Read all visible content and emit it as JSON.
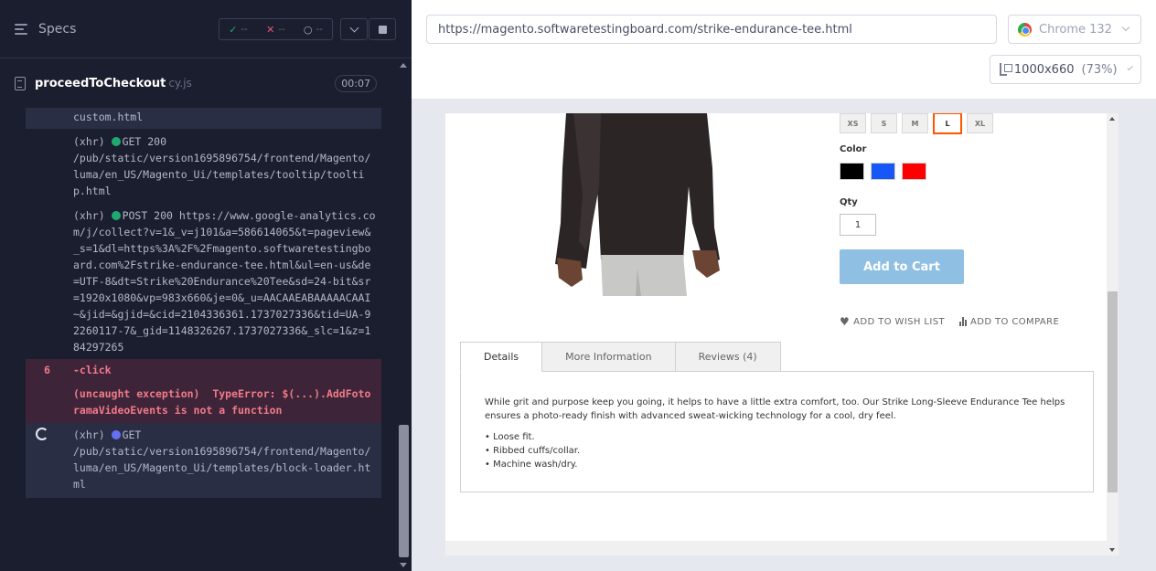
{
  "reporter": {
    "specs_label": "Specs",
    "stats": {
      "passed": "--",
      "failed": "--",
      "pending": "--"
    },
    "spec_name": "proceedToCheckout",
    "spec_ext": "cy.js",
    "duration": "00:07",
    "log": [
      {
        "text": "custom.html"
      },
      {
        "method": "(xhr)",
        "status": "GET 200",
        "url": "/pub/static/version1695896754/frontend/Magento/luma/en_US/Magento_Ui/templates/tooltip/tooltip.html"
      },
      {
        "method": "(xhr)",
        "status": "POST 200",
        "url": "https://www.google-analytics.com/j/collect?v=1&_v=j101&a=586614065&t=pageview&_s=1&dl=https%3A%2F%2Fmagento.softwaretestingboard.com%2Fstrike-endurance-tee.html&ul=en-us&de=UTF-8&dt=Strike%20Endurance%20Tee&sd=24-bit&sr=1920x1080&vp=983x660&je=0&_u=AACAAEABAAAAACAAI~&jid=&gjid=&cid=2104336361.1737027336&tid=UA-92260117-7&_gid=1148326267.1737027336&_slc=1&z=184297265"
      },
      {
        "line": "6",
        "command": "-click"
      },
      {
        "error": "(uncaught exception)  TypeError: $(...).AddFotoramaVideoEvents is not a function"
      },
      {
        "method": "(xhr)",
        "status": "GET",
        "url": "/pub/static/version1695896754/frontend/Magento/luma/en_US/Magento_Ui/templates/block-loader.html"
      }
    ]
  },
  "aut": {
    "url": "https://magento.softwaretestingboard.com/strike-endurance-tee.html",
    "browser": "Chrome 132",
    "viewport": "1000x660",
    "zoom": "(73%)"
  },
  "product": {
    "sizes": [
      "XS",
      "S",
      "M",
      "L",
      "XL"
    ],
    "selected_size": "L",
    "color_label": "Color",
    "colors": [
      "#000000",
      "#1857f7",
      "#ff0000"
    ],
    "qty_label": "Qty",
    "qty_value": "1",
    "add_to_cart": "Add to Cart",
    "wishlist": "ADD TO WISH LIST",
    "compare": "ADD TO COMPARE",
    "tabs": [
      "Details",
      "More Information",
      "Reviews (4)"
    ],
    "description": "While grit and purpose keep you going, it helps to have a little extra comfort, too. Our Strike Long-Sleeve Endurance Tee helps ensures a photo-ready finish with advanced sweat-wicking technology for a cool, dry feel.",
    "features": [
      "• Loose fit.",
      "• Ribbed cuffs/collar.",
      "• Machine wash/dry."
    ]
  }
}
